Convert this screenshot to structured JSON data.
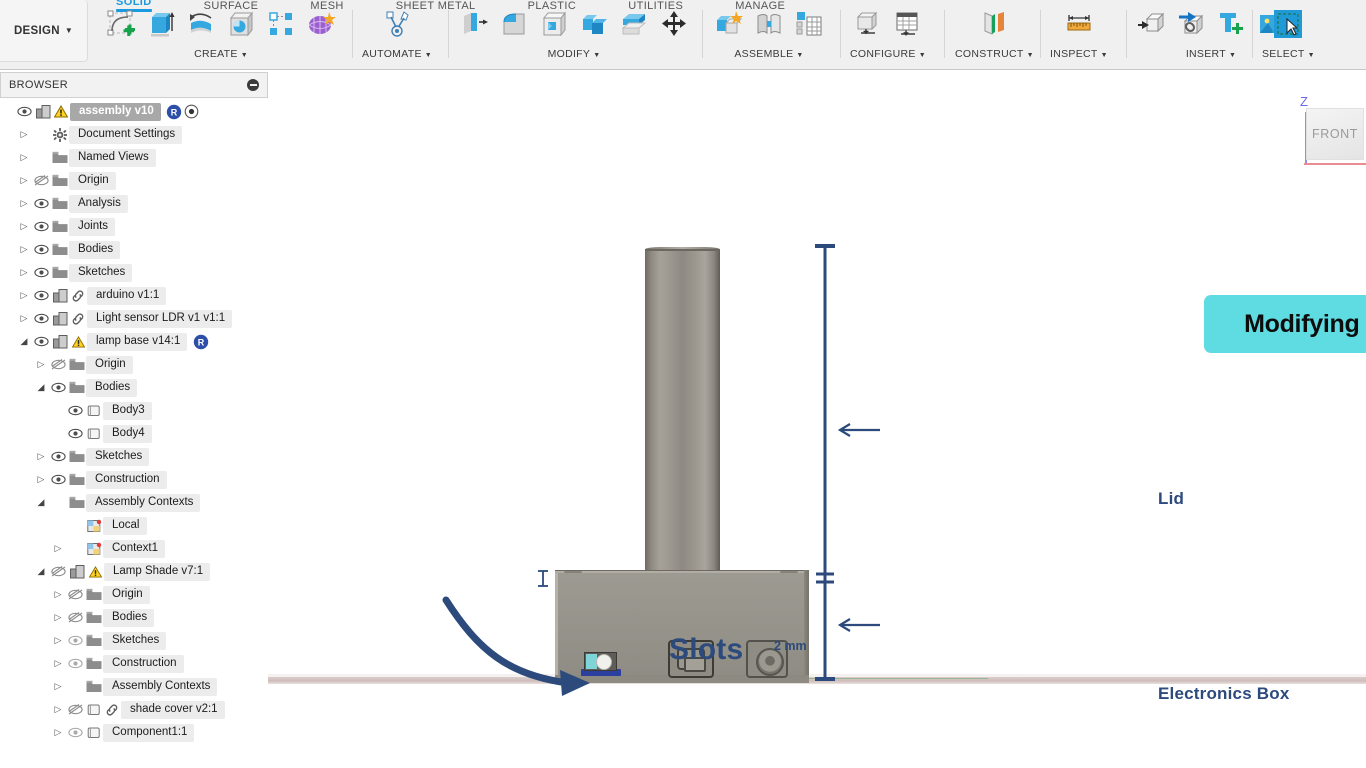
{
  "app": {
    "workspace_label": "DESIGN",
    "tabs": [
      {
        "label": "SOLID",
        "active": true
      },
      {
        "label": "SURFACE",
        "active": false
      },
      {
        "label": "MESH",
        "active": false
      },
      {
        "label": "SHEET METAL",
        "active": false
      },
      {
        "label": "PLASTIC",
        "active": false
      },
      {
        "label": "UTILITIES",
        "active": false
      },
      {
        "label": "MANAGE",
        "active": false
      }
    ],
    "panels": [
      {
        "label": "CREATE",
        "dropdown": true,
        "icons": [
          "create-sketch-icon",
          "extrude-icon",
          "revolve-icon",
          "hole-icon",
          "pattern-icon",
          "form-icon"
        ]
      },
      {
        "label": "AUTOMATE",
        "dropdown": true,
        "icons": [
          "automate-icon"
        ]
      },
      {
        "label": "MODIFY",
        "dropdown": true,
        "icons": [
          "press-pull-icon",
          "fillet-icon",
          "shell-icon",
          "combine-icon",
          "offset-face-icon",
          "move-copy-icon"
        ]
      },
      {
        "label": "ASSEMBLE",
        "dropdown": true,
        "icons": [
          "new-component-icon",
          "joint-icon",
          "bom-icon"
        ]
      },
      {
        "label": "CONFIGURE",
        "dropdown": true,
        "icons": [
          "configuration-icon",
          "configuration-table-icon"
        ]
      },
      {
        "label": "CONSTRUCT",
        "dropdown": true,
        "icons": [
          "offset-plane-icon"
        ]
      },
      {
        "label": "INSPECT",
        "dropdown": true,
        "icons": [
          "measure-icon"
        ]
      },
      {
        "label": "INSERT",
        "dropdown": true,
        "icons": [
          "insert-derive-icon",
          "insert-mcmaster-icon",
          "insert-mfg-icon",
          "insert-canvas-icon"
        ]
      },
      {
        "label": "SELECT",
        "dropdown": true,
        "icons": [
          "select-window-icon"
        ]
      }
    ]
  },
  "browser": {
    "title": "BROWSER",
    "collapse_icon": "minus-circle-icon",
    "root": {
      "label": "assembly v10",
      "visible": true,
      "warning": true,
      "selected": true,
      "badge": "R"
    },
    "items": [
      {
        "label": "Document Settings",
        "indent": 1,
        "arrow": "closed",
        "eye": "none",
        "icon": "gear-icon"
      },
      {
        "label": "Named Views",
        "indent": 1,
        "arrow": "closed",
        "eye": "none",
        "icon": "folder-icon"
      },
      {
        "label": "Origin",
        "indent": 1,
        "arrow": "closed",
        "eye": "hidden",
        "icon": "folder-icon"
      },
      {
        "label": "Analysis",
        "indent": 1,
        "arrow": "closed",
        "eye": "visible",
        "icon": "folder-icon"
      },
      {
        "label": "Joints",
        "indent": 1,
        "arrow": "closed",
        "eye": "visible",
        "icon": "folder-icon"
      },
      {
        "label": "Bodies",
        "indent": 1,
        "arrow": "closed",
        "eye": "visible",
        "icon": "folder-icon"
      },
      {
        "label": "Sketches",
        "indent": 1,
        "arrow": "closed",
        "eye": "visible",
        "icon": "folder-icon"
      },
      {
        "label": "arduino v1:1",
        "indent": 1,
        "arrow": "closed",
        "eye": "visible",
        "icon": "component-icon",
        "link": true
      },
      {
        "label": "Light sensor LDR v1 v1:1",
        "indent": 1,
        "arrow": "closed",
        "eye": "visible",
        "icon": "component-icon",
        "link": true
      },
      {
        "label": "lamp base v14:1",
        "indent": 1,
        "arrow": "open",
        "eye": "visible",
        "icon": "component-icon",
        "link": true,
        "warning": true,
        "badge": "R"
      },
      {
        "label": "Origin",
        "indent": 2,
        "arrow": "closed",
        "eye": "hidden",
        "icon": "folder-icon"
      },
      {
        "label": "Bodies",
        "indent": 2,
        "arrow": "open",
        "eye": "visible",
        "icon": "folder-icon"
      },
      {
        "label": "Body3",
        "indent": 3,
        "arrow": "none",
        "eye": "visible",
        "icon": "body-icon"
      },
      {
        "label": "Body4",
        "indent": 3,
        "arrow": "none",
        "eye": "visible",
        "icon": "body-icon"
      },
      {
        "label": "Sketches",
        "indent": 2,
        "arrow": "closed",
        "eye": "visible",
        "icon": "folder-icon"
      },
      {
        "label": "Construction",
        "indent": 2,
        "arrow": "closed",
        "eye": "visible",
        "icon": "folder-icon"
      },
      {
        "label": "Assembly Contexts",
        "indent": 2,
        "arrow": "open",
        "eye": "none",
        "icon": "folder-icon"
      },
      {
        "label": "Local",
        "indent": 3,
        "arrow": "none",
        "eye": "none",
        "icon": "context-icon"
      },
      {
        "label": "Context1",
        "indent": 3,
        "arrow": "closed",
        "eye": "none",
        "icon": "context-icon"
      },
      {
        "label": "Lamp Shade v7:1",
        "indent": 2,
        "arrow": "open",
        "eye": "hidden",
        "icon": "component-icon",
        "link": true,
        "warning": true
      },
      {
        "label": "Origin",
        "indent": 3,
        "arrow": "closed",
        "eye": "hidden",
        "icon": "folder-icon"
      },
      {
        "label": "Bodies",
        "indent": 3,
        "arrow": "closed",
        "eye": "hidden",
        "icon": "folder-icon"
      },
      {
        "label": "Sketches",
        "indent": 3,
        "arrow": "closed",
        "eye": "dim",
        "icon": "folder-icon"
      },
      {
        "label": "Construction",
        "indent": 3,
        "arrow": "closed",
        "eye": "dim",
        "icon": "folder-icon"
      },
      {
        "label": "Assembly Contexts",
        "indent": 3,
        "arrow": "closed",
        "eye": "none",
        "icon": "folder-icon"
      },
      {
        "label": "shade cover v2:1",
        "indent": 3,
        "arrow": "closed",
        "eye": "hidden",
        "icon": "body-icon",
        "link": true
      },
      {
        "label": "Component1:1",
        "indent": 3,
        "arrow": "closed",
        "eye": "dim",
        "icon": "body-icon"
      }
    ]
  },
  "annotations": {
    "title_badge": "Modifying the Base",
    "title_badge_color": "#5fdbe2",
    "callout_color": "#2c4a7c",
    "lid_label": "Lid",
    "electronics_box_label": "Electronics Box",
    "slots_label": "Slots",
    "thickness_label": "2 mm"
  },
  "viewcube": {
    "face": "FRONT",
    "axis_label": "Z"
  }
}
